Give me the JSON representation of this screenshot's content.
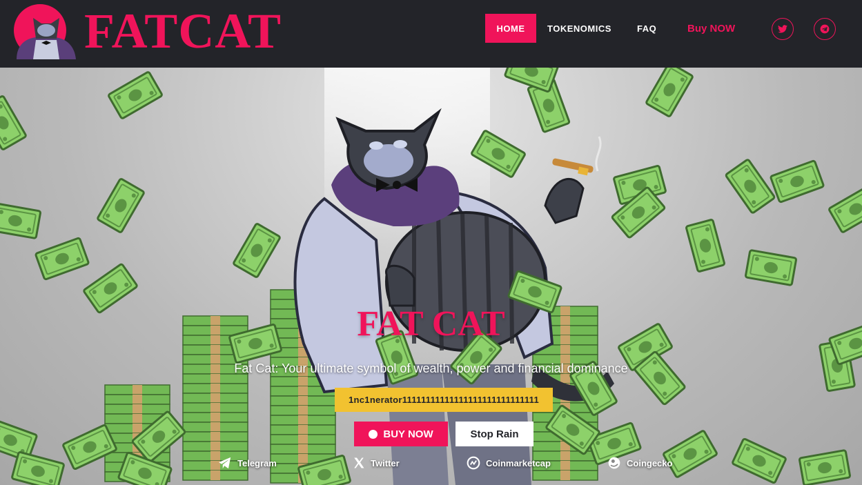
{
  "brand": {
    "logo_text": "FATCAT",
    "accent_color": "#f0145a",
    "nav_bg_color": "#232429"
  },
  "nav": {
    "items": [
      {
        "label": "HOME",
        "active": true
      },
      {
        "label": "TOKENOMICS",
        "active": false
      },
      {
        "label": "FAQ",
        "active": false
      }
    ],
    "buy_label": "Buy NOW",
    "social_icons": [
      "twitter-icon",
      "telegram-icon"
    ]
  },
  "hero": {
    "title": "FAT CAT",
    "subtitle": "Fat Cat: Your ultimate symbol of wealth, power and financial dominance",
    "contract": "1nc1nerator11111111111111111111111111111",
    "contract_bg_color": "#f2c230",
    "buy_button_label": "BUY NOW",
    "stop_rain_label": "Stop Rain"
  },
  "links": [
    {
      "label": "Telegram",
      "icon": "telegram-icon"
    },
    {
      "label": "Twitter",
      "icon": "x-icon"
    },
    {
      "label": "Coinmarketcap",
      "icon": "coinmarketcap-icon"
    },
    {
      "label": "Coingecko",
      "icon": "coingecko-icon"
    }
  ]
}
